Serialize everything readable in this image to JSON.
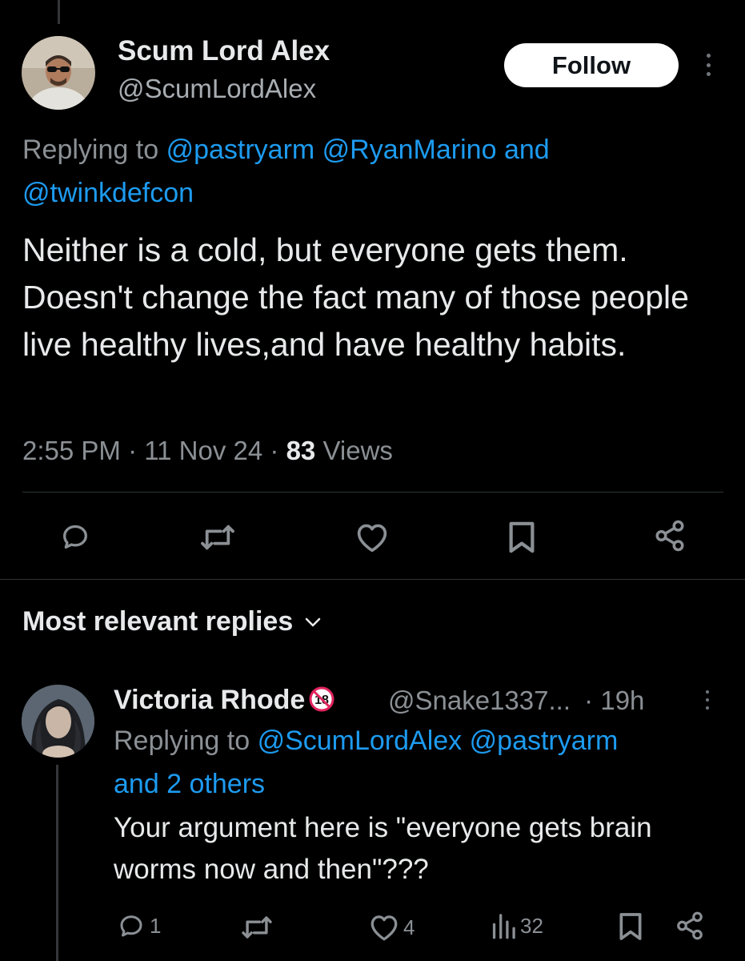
{
  "tweet": {
    "author_name": "Scum Lord Alex",
    "author_handle": "@ScumLordAlex",
    "follow_label": "Follow",
    "replying_prefix": "Replying to",
    "replying_mentions": [
      "@pastryarm",
      "@RyanMarino",
      "@twinkdefcon"
    ],
    "replying_and": "and",
    "text": "Neither is a cold, but everyone gets them. Doesn't change the fact many of those people live healthy lives,and have healthy habits.",
    "time": "2:55 PM",
    "date": "11 Nov 24",
    "views_count": "83",
    "views_label": "Views",
    "separator": "·"
  },
  "replies_section": {
    "title": "Most relevant replies"
  },
  "reply": {
    "author_name": "Victoria Rhode",
    "author_handle": "@Snake1337...",
    "time_ago": "19h",
    "replying_prefix": "Replying to",
    "replying_mentions": [
      "@ScumLordAlex",
      "@pastryarm"
    ],
    "replying_others": "and 2 others",
    "text": "Your argument here is \"everyone gets brain worms now and then\"???",
    "reply_count": "1",
    "like_count": "4",
    "view_count": "32"
  },
  "colors": {
    "background": "#000000",
    "text": "#e7e9ea",
    "secondary": "#8b9095",
    "accent": "#1d9bf0",
    "divider": "#2f3336"
  },
  "icons": [
    "kebab-icon",
    "reply-icon",
    "retweet-icon",
    "like-icon",
    "bookmark-icon",
    "share-icon",
    "chevron-down-icon",
    "views-icon",
    "no-18-icon"
  ]
}
